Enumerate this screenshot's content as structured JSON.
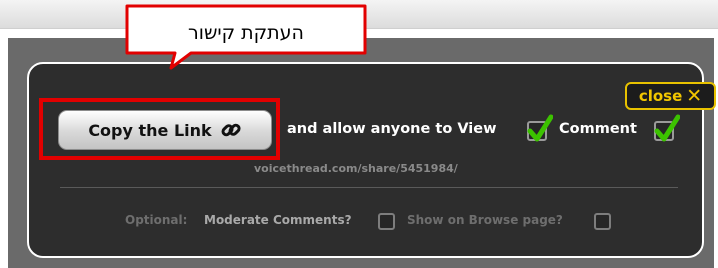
{
  "callout": {
    "text": "העתקת קישור"
  },
  "share_dialog": {
    "close_label": "close",
    "close_icon": "close-x-icon",
    "copy_link_label": "Copy the Link",
    "copy_link_icon": "link-icon",
    "allow_view_label": "and allow anyone to View",
    "view_checked": true,
    "comment_label": "Comment",
    "comment_checked": true,
    "share_url": "voicethread.com/share/5451984/",
    "optional_label": "Optional:",
    "moderate_label": "Moderate Comments?",
    "moderate_checked": false,
    "browse_label": "Show on Browse page?",
    "browse_checked": false
  },
  "colors": {
    "panel_bg": "#2d2d2d",
    "accent_yellow": "#f2c600",
    "highlight_red": "#e20000",
    "check_green": "#3cc200"
  }
}
